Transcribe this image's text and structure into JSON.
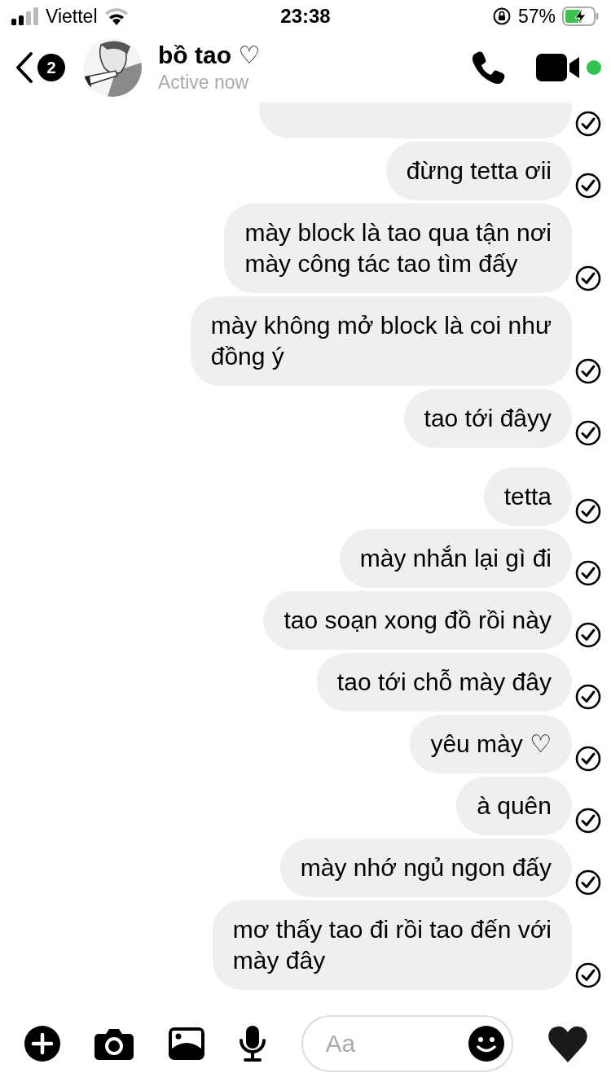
{
  "status_bar": {
    "carrier": "Viettel",
    "time": "23:38",
    "battery": "57%"
  },
  "header": {
    "back_badge": "2",
    "name": "bồ tao ♡",
    "status": "Active now",
    "online": true
  },
  "messages": [
    {
      "text": "đừng tetta ơii",
      "seen": true,
      "break_before": false
    },
    {
      "text": "mày block là tao qua tận nơi\nmày công tác tao tìm đấy",
      "seen": true,
      "break_before": false
    },
    {
      "text": "mày không mở block là coi như\nđồng ý",
      "seen": true,
      "break_before": false
    },
    {
      "text": "tao tới đâyy",
      "seen": true,
      "break_before": false
    },
    {
      "text": "tetta",
      "seen": true,
      "break_before": true
    },
    {
      "text": "mày nhắn lại gì đi",
      "seen": true,
      "break_before": false
    },
    {
      "text": "tao soạn xong đồ rồi này",
      "seen": true,
      "break_before": false
    },
    {
      "text": "tao tới chỗ mày đây",
      "seen": true,
      "break_before": false
    },
    {
      "text": "yêu mày ♡",
      "seen": true,
      "break_before": false
    },
    {
      "text": "à quên",
      "seen": true,
      "break_before": false
    },
    {
      "text": "mày nhớ ngủ ngon đấy",
      "seen": true,
      "break_before": false
    },
    {
      "text": "mơ thấy tao đi rồi tao đến với\nmày đây",
      "seen": true,
      "break_before": false
    }
  ],
  "composer": {
    "placeholder": "Aa"
  }
}
